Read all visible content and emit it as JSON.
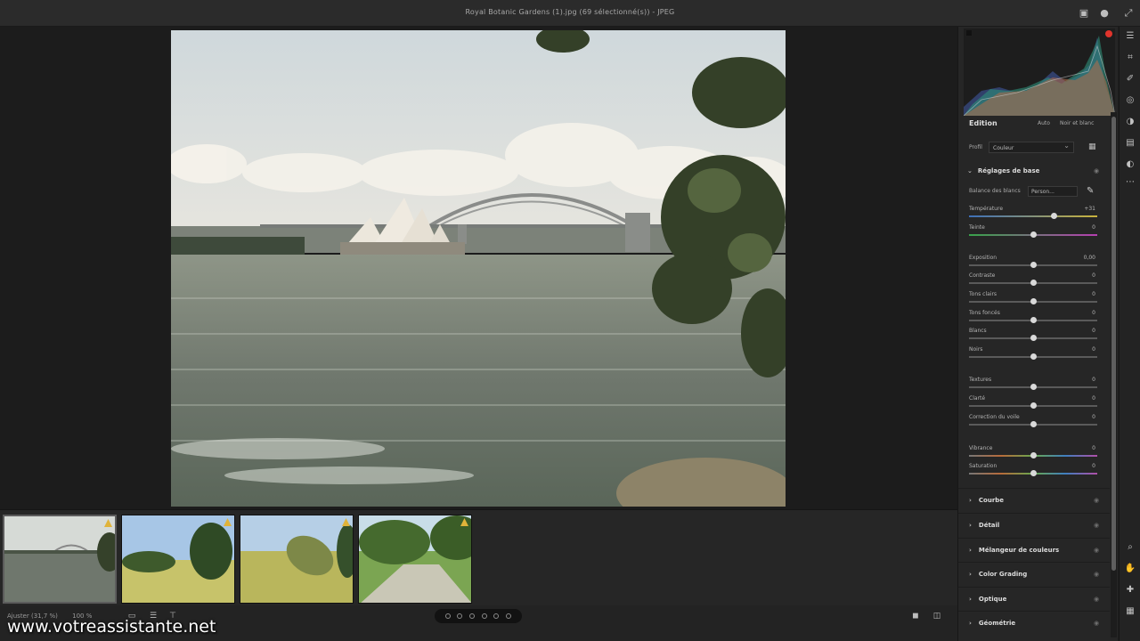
{
  "window": {
    "title": "Royal Botanic Gardens (1).jpg (69 sélectionné(s))  -  JPEG"
  },
  "filmstrip": {
    "thumbnails": [
      {
        "name": "opera-bridge",
        "selected": true
      },
      {
        "name": "park-trees",
        "selected": false
      },
      {
        "name": "topiary",
        "selected": false
      },
      {
        "name": "path-trees",
        "selected": false
      }
    ]
  },
  "bottom": {
    "zoom_label": "Ajuster (31,7 %)",
    "zoom_value": "100 %"
  },
  "watermark": "www.votreassistante.net",
  "panel": {
    "edit_title": "Edition",
    "auto_label": "Auto",
    "bw_label": "Noir et blanc",
    "profile_label": "Profil",
    "profile_value": "Couleur",
    "basic_title": "Réglages de base",
    "wb_label": "Balance des blancs",
    "wb_value": "Person...",
    "sliders": [
      {
        "label": "Température",
        "value": "+31",
        "pos": 0.66
      },
      {
        "label": "Teinte",
        "value": "0",
        "pos": 0.5
      },
      {
        "label": "Exposition",
        "value": "0,00",
        "pos": 0.5
      },
      {
        "label": "Contraste",
        "value": "0",
        "pos": 0.5
      },
      {
        "label": "Tons clairs",
        "value": "0",
        "pos": 0.5
      },
      {
        "label": "Tons foncés",
        "value": "0",
        "pos": 0.5
      },
      {
        "label": "Blancs",
        "value": "0",
        "pos": 0.5
      },
      {
        "label": "Noirs",
        "value": "0",
        "pos": 0.5
      },
      {
        "label": "Textures",
        "value": "0",
        "pos": 0.5
      },
      {
        "label": "Clarté",
        "value": "0",
        "pos": 0.5
      },
      {
        "label": "Correction du voile",
        "value": "0",
        "pos": 0.5
      },
      {
        "label": "Vibrance",
        "value": "0",
        "pos": 0.5
      },
      {
        "label": "Saturation",
        "value": "0",
        "pos": 0.5
      }
    ],
    "sections": [
      {
        "label": "Courbe"
      },
      {
        "label": "Détail"
      },
      {
        "label": "Mélangeur de couleurs"
      },
      {
        "label": "Color Grading"
      },
      {
        "label": "Optique"
      },
      {
        "label": "Géométrie"
      }
    ]
  },
  "colors": {
    "accent_red": "#e0342c",
    "flag_yellow": "#e0b33a",
    "panel_bg": "#262626"
  },
  "icons": [
    "share-icon",
    "account-icon",
    "expand-icon",
    "edit-icon",
    "crop-icon",
    "heal-icon",
    "mask-icon",
    "redeye-icon",
    "presets-icon",
    "snapshots-icon",
    "more-icon",
    "zoom-icon",
    "hand-icon",
    "eyedropper-icon",
    "grid-icon"
  ]
}
